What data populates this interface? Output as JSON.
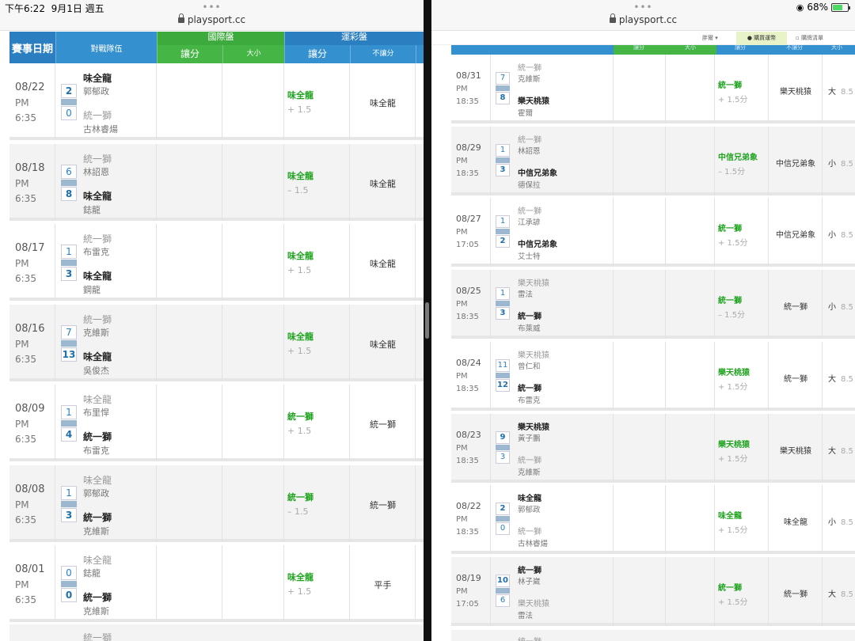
{
  "status": {
    "time": "下午6:22",
    "date": "9月1日 週五",
    "battery": "68%",
    "battery_level": 0.68
  },
  "left_browser": {
    "dots": "•••",
    "url": "playsport.cc"
  },
  "right_browser": {
    "dots": "•••",
    "url": "playsport.cc"
  },
  "left_table": {
    "headers": {
      "date": "賽事日期",
      "teams": "對戰隊伍",
      "intl": "國際盤",
      "intl_handicap": "讓分",
      "intl_ou": "大小",
      "lottery": "運彩盤",
      "lot_handicap": "讓分",
      "lot_no_handicap": "不讓分"
    },
    "rows": [
      {
        "date": "08/22",
        "ampm": "PM",
        "time": "6:35",
        "away_score": "2",
        "away_team": "味全龍",
        "away_pitcher": "郭郁政",
        "home_score": "0",
        "home_team": "統一獅",
        "home_pitcher": "古林睿煬",
        "winner": "away",
        "hc_team": "味全龍",
        "hc_val": "+ 1.5",
        "result": "味全龍"
      },
      {
        "date": "08/18",
        "ampm": "PM",
        "time": "6:35",
        "away_score": "6",
        "away_team": "統一獅",
        "away_pitcher": "林詔恩",
        "home_score": "8",
        "home_team": "味全龍",
        "home_pitcher": "鋕龍",
        "winner": "home",
        "hc_team": "味全龍",
        "hc_val": "– 1.5",
        "result": "味全龍"
      },
      {
        "date": "08/17",
        "ampm": "PM",
        "time": "6:35",
        "away_score": "1",
        "away_team": "統一獅",
        "away_pitcher": "布雷克",
        "home_score": "3",
        "home_team": "味全龍",
        "home_pitcher": "鋼龍",
        "winner": "home",
        "hc_team": "味全龍",
        "hc_val": "+ 1.5",
        "result": "味全龍"
      },
      {
        "date": "08/16",
        "ampm": "PM",
        "time": "6:35",
        "away_score": "7",
        "away_team": "統一獅",
        "away_pitcher": "克維斯",
        "home_score": "13",
        "home_team": "味全龍",
        "home_pitcher": "吳俊杰",
        "winner": "home",
        "hc_team": "味全龍",
        "hc_val": "+ 1.5",
        "result": "味全龍"
      },
      {
        "date": "08/09",
        "ampm": "PM",
        "time": "6:35",
        "away_score": "1",
        "away_team": "味全龍",
        "away_pitcher": "布里悍",
        "home_score": "4",
        "home_team": "統一獅",
        "home_pitcher": "布雷克",
        "winner": "home",
        "hc_team": "統一獅",
        "hc_val": "+ 1.5",
        "result": "統一獅"
      },
      {
        "date": "08/08",
        "ampm": "PM",
        "time": "6:35",
        "away_score": "1",
        "away_team": "味全龍",
        "away_pitcher": "郭郁政",
        "home_score": "3",
        "home_team": "統一獅",
        "home_pitcher": "克維斯",
        "winner": "home",
        "hc_team": "統一獅",
        "hc_val": "– 1.5",
        "result": "統一獅"
      },
      {
        "date": "08/01",
        "ampm": "PM",
        "time": "6:35",
        "away_score": "0",
        "away_team": "味全龍",
        "away_pitcher": "鋕龍",
        "home_score": "0",
        "home_team": "統一獅",
        "home_pitcher": "克維斯",
        "winner": "home",
        "hc_team": "味全龍",
        "hc_val": "+ 1.5",
        "result": "平手"
      }
    ],
    "partial_team": "統一獅"
  },
  "right_toolbar": {
    "item1": "胖爾 ▾",
    "buy": "購買運幣",
    "item3": "購牌清單"
  },
  "right_header": {
    "h1": "讓分",
    "h2": "大小",
    "h3": "讓分",
    "h4": "不讓分",
    "h5": "大小"
  },
  "right_table": {
    "rows": [
      {
        "date": "08/31",
        "ampm": "PM",
        "time": "18:35",
        "away_score": "7",
        "away_team": "統一獅",
        "away_pitcher": "克維斯",
        "home_score": "8",
        "home_team": "樂天桃猿",
        "home_pitcher": "霍爾",
        "winner": "home",
        "hc_team": "統一獅",
        "hc_val": "+ 1.5分",
        "result": "樂天桃猿",
        "ou": "大",
        "ou_val": "8.5"
      },
      {
        "date": "08/29",
        "ampm": "PM",
        "time": "18:35",
        "away_score": "1",
        "away_team": "統一獅",
        "away_pitcher": "林詔恩",
        "home_score": "3",
        "home_team": "中信兄弟象",
        "home_pitcher": "德保拉",
        "winner": "home",
        "hc_team": "中信兄弟象",
        "hc_val": "– 1.5分",
        "result": "中信兄弟象",
        "ou": "小",
        "ou_val": "8.5"
      },
      {
        "date": "08/27",
        "ampm": "PM",
        "time": "17:05",
        "away_score": "1",
        "away_team": "統一獅",
        "away_pitcher": "江承諺",
        "home_score": "2",
        "home_team": "中信兄弟象",
        "home_pitcher": "艾士特",
        "winner": "home",
        "hc_team": "統一獅",
        "hc_val": "+ 1.5分",
        "result": "中信兄弟象",
        "ou": "小",
        "ou_val": "8.5"
      },
      {
        "date": "08/25",
        "ampm": "PM",
        "time": "18:35",
        "away_score": "1",
        "away_team": "樂天桃猿",
        "away_pitcher": "雷法",
        "home_score": "3",
        "home_team": "統一獅",
        "home_pitcher": "布萊威",
        "winner": "home",
        "hc_team": "統一獅",
        "hc_val": "– 1.5分",
        "result": "統一獅",
        "ou": "小",
        "ou_val": "8.5"
      },
      {
        "date": "08/24",
        "ampm": "PM",
        "time": "18:35",
        "away_score": "11",
        "away_team": "樂天桃猿",
        "away_pitcher": "曾仁和",
        "home_score": "12",
        "home_team": "統一獅",
        "home_pitcher": "布雷克",
        "winner": "home",
        "hc_team": "樂天桃猿",
        "hc_val": "+ 1.5分",
        "result": "統一獅",
        "ou": "大",
        "ou_val": "8.5"
      },
      {
        "date": "08/23",
        "ampm": "PM",
        "time": "18:35",
        "away_score": "9",
        "away_team": "樂天桃猿",
        "away_pitcher": "黃子鵬",
        "home_score": "3",
        "home_team": "統一獅",
        "home_pitcher": "克維斯",
        "winner": "away",
        "hc_team": "樂天桃猿",
        "hc_val": "+ 1.5分",
        "result": "樂天桃猿",
        "ou": "大",
        "ou_val": "8.5"
      },
      {
        "date": "08/22",
        "ampm": "PM",
        "time": "18:35",
        "away_score": "2",
        "away_team": "味全龍",
        "away_pitcher": "郭郁政",
        "home_score": "0",
        "home_team": "統一獅",
        "home_pitcher": "古林睿煬",
        "winner": "away",
        "hc_team": "味全龍",
        "hc_val": "+ 1.5分",
        "result": "味全龍",
        "ou": "小",
        "ou_val": "8.5"
      },
      {
        "date": "08/19",
        "ampm": "PM",
        "time": "17:05",
        "away_score": "10",
        "away_team": "統一獅",
        "away_pitcher": "林子崴",
        "home_score": "6",
        "home_team": "樂天桃猿",
        "home_pitcher": "雷法",
        "winner": "away",
        "hc_team": "統一獅",
        "hc_val": "+ 1.5分",
        "result": "統一獅",
        "ou": "大",
        "ou_val": "8.5"
      }
    ],
    "partial_team": "統一獅"
  }
}
